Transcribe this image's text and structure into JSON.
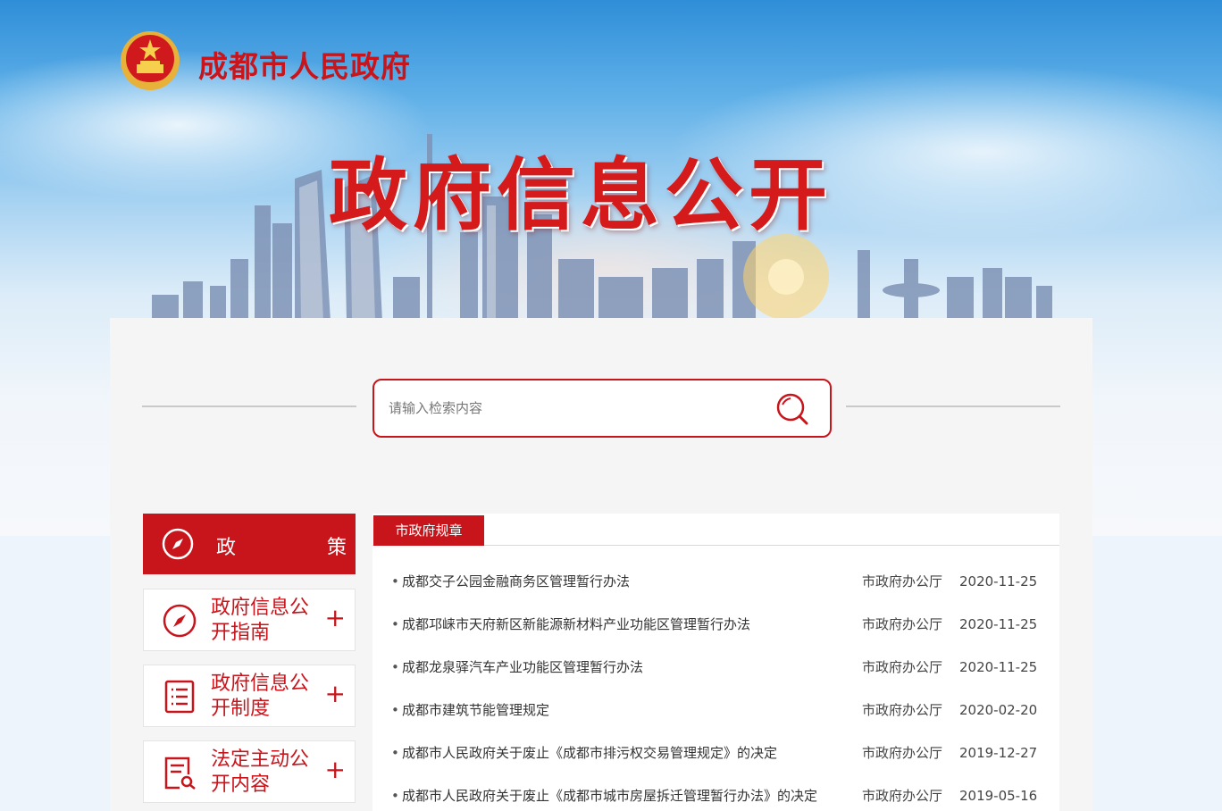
{
  "header": {
    "site_title": "成都市人民政府",
    "banner_title": "政府信息公开"
  },
  "search": {
    "placeholder": "请输入检索内容",
    "icon": "search-icon"
  },
  "sidebar": {
    "active": {
      "label": "政　策",
      "icon": "compass-icon"
    },
    "items": [
      {
        "label": "政府信息公开指南",
        "icon": "compass-icon",
        "expand": "+"
      },
      {
        "label": "政府信息公开制度",
        "icon": "list-icon",
        "expand": "+"
      },
      {
        "label": "法定主动公开内容",
        "icon": "document-search-icon",
        "expand": "+"
      }
    ]
  },
  "content": {
    "tab_label": "市政府规章",
    "rows": [
      {
        "bullet": "•",
        "title": "成都交子公园金融商务区管理暂行办法",
        "dept": "市政府办公厅",
        "date": "2020-11-25"
      },
      {
        "bullet": "•",
        "title": "成都邛崃市天府新区新能源新材料产业功能区管理暂行办法",
        "dept": "市政府办公厅",
        "date": "2020-11-25"
      },
      {
        "bullet": "•",
        "title": "成都龙泉驿汽车产业功能区管理暂行办法",
        "dept": "市政府办公厅",
        "date": "2020-11-25"
      },
      {
        "bullet": "•",
        "title": "成都市建筑节能管理规定",
        "dept": "市政府办公厅",
        "date": "2020-02-20"
      },
      {
        "bullet": "•",
        "title": "成都市人民政府关于废止《成都市排污权交易管理规定》的决定",
        "dept": "市政府办公厅",
        "date": "2019-12-27"
      },
      {
        "bullet": "•",
        "title": "成都市人民政府关于废止《成都市城市房屋拆迁管理暂行办法》的决定",
        "dept": "市政府办公厅",
        "date": "2019-05-16"
      }
    ]
  },
  "colors": {
    "accent": "#c8141b",
    "panel_bg": "#f5f5f5"
  }
}
